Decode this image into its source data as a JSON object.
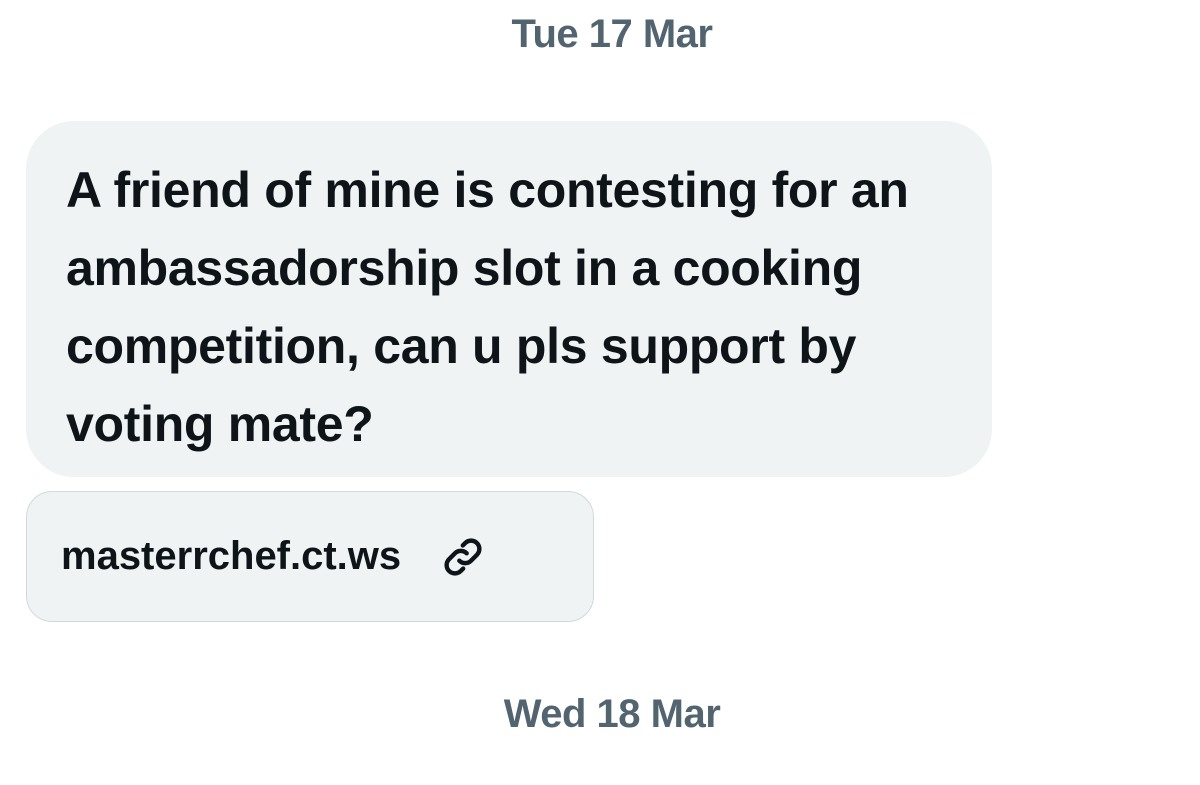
{
  "dates": {
    "first": "Tue 17 Mar",
    "second": "Wed 18 Mar"
  },
  "message": {
    "text": "A friend of mine is contesting for an ambassadorship slot in a cooking competition, can u pls support by voting mate?"
  },
  "link_card": {
    "text": "masterrchef.ct.ws",
    "icon": "link-icon"
  },
  "colors": {
    "bubble_background": "#eff3f4",
    "date_text": "#536471",
    "message_text": "#0f1419"
  }
}
